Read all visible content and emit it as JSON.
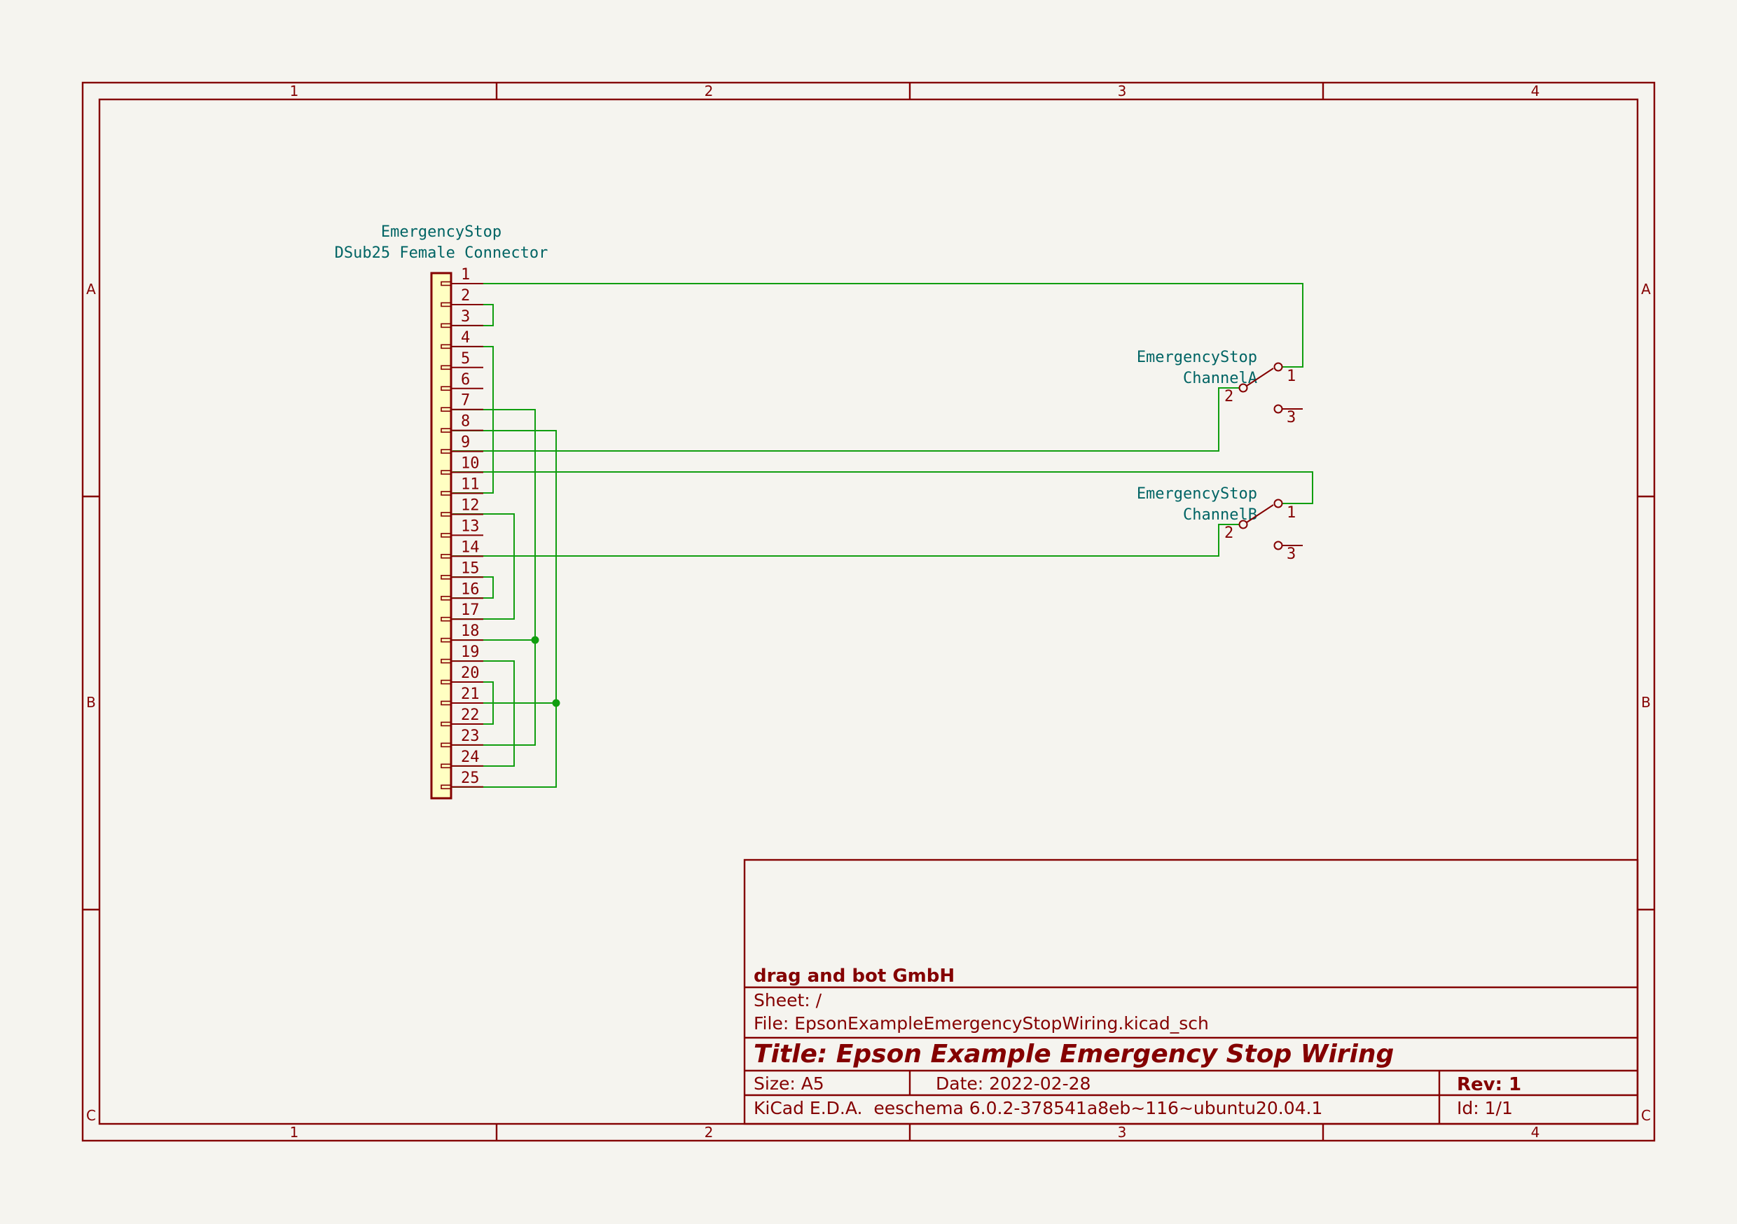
{
  "frame": {
    "columns": [
      "1",
      "2",
      "3",
      "4"
    ],
    "rows": [
      "A",
      "B",
      "C"
    ]
  },
  "connector": {
    "ref": "EmergencyStop",
    "value": "DSub25 Female Connector",
    "pins": [
      "1",
      "2",
      "3",
      "4",
      "5",
      "6",
      "7",
      "8",
      "9",
      "10",
      "11",
      "12",
      "13",
      "14",
      "15",
      "16",
      "17",
      "18",
      "19",
      "20",
      "21",
      "22",
      "23",
      "24",
      "25"
    ]
  },
  "switch_a": {
    "ref": "EmergencyStop",
    "value": "ChannelA",
    "pins": [
      "1",
      "2",
      "3"
    ]
  },
  "switch_b": {
    "ref": "EmergencyStop",
    "value": "ChannelB",
    "pins": [
      "1",
      "2",
      "3"
    ]
  },
  "title_block": {
    "company": "drag and bot GmbH",
    "sheet": "Sheet: /",
    "file": "File: EpsonExampleEmergencyStopWiring.kicad_sch",
    "title": "Title: Epson Example Emergency Stop Wiring",
    "size": "Size: A5",
    "date": "Date: 2022-02-28",
    "rev": "Rev: 1",
    "tool": "KiCad E.D.A.  eeschema 6.0.2-378541a8eb~116~ubuntu20.04.1",
    "id": "Id: 1/1"
  },
  "colors": {
    "border": "#840000",
    "wire": "#109e10",
    "reference": "#006464",
    "component_fill": "#ffffc2",
    "background": "#f5f4ef"
  }
}
